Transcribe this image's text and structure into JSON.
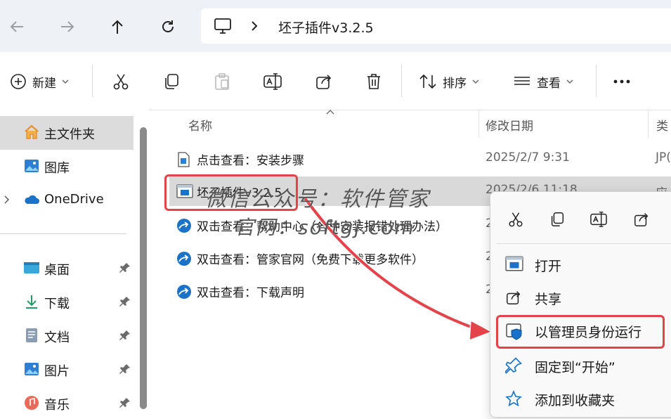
{
  "nav": {
    "back": "back-arrow-icon",
    "forward": "forward-arrow-icon",
    "up": "up-arrow-icon",
    "refresh": "refresh-icon"
  },
  "address": {
    "crumb": "坯子插件v3.2.5"
  },
  "toolbar": {
    "new_label": "新建",
    "sort_label": "排序",
    "view_label": "查看",
    "more": "…"
  },
  "sidebar": {
    "items": [
      {
        "label": "主文件夹"
      },
      {
        "label": "图库"
      },
      {
        "label": "OneDrive"
      },
      {
        "label": "桌面"
      },
      {
        "label": "下载"
      },
      {
        "label": "文档"
      },
      {
        "label": "图片"
      },
      {
        "label": "音乐"
      }
    ]
  },
  "columns": {
    "name": "名称",
    "modified": "修改日期",
    "type": "类"
  },
  "files": [
    {
      "name": "点击查看：安装步骤",
      "date": "2025/2/7 9:31",
      "type": "JP("
    },
    {
      "name": "坯子插件v3.2.5",
      "date": "2025/2/6 11:18",
      "type": "应"
    },
    {
      "name": "双击查看：帮助中心（各种安装报错处理办法）",
      "date": "2",
      "type": ""
    },
    {
      "name": "双击查看：管家官网（免费下载更多软件）",
      "date": "2",
      "type": ""
    },
    {
      "name": "双击查看：下载声明",
      "date": "2",
      "type": ""
    }
  ],
  "context_menu": {
    "items": [
      {
        "label": "打开"
      },
      {
        "label": "共享"
      },
      {
        "label": "以管理员身份运行"
      },
      {
        "label": "固定到“开始”"
      },
      {
        "label": "添加到收藏夹"
      }
    ]
  },
  "watermark": {
    "line1": "微信公众号：软件管家",
    "line2": "官网：softgj.com"
  },
  "colors": {
    "accent": "#0067c0",
    "highlight_red": "#e4434a",
    "selected_row": "#d9d9d9",
    "folder_orange": "#e8912d"
  }
}
